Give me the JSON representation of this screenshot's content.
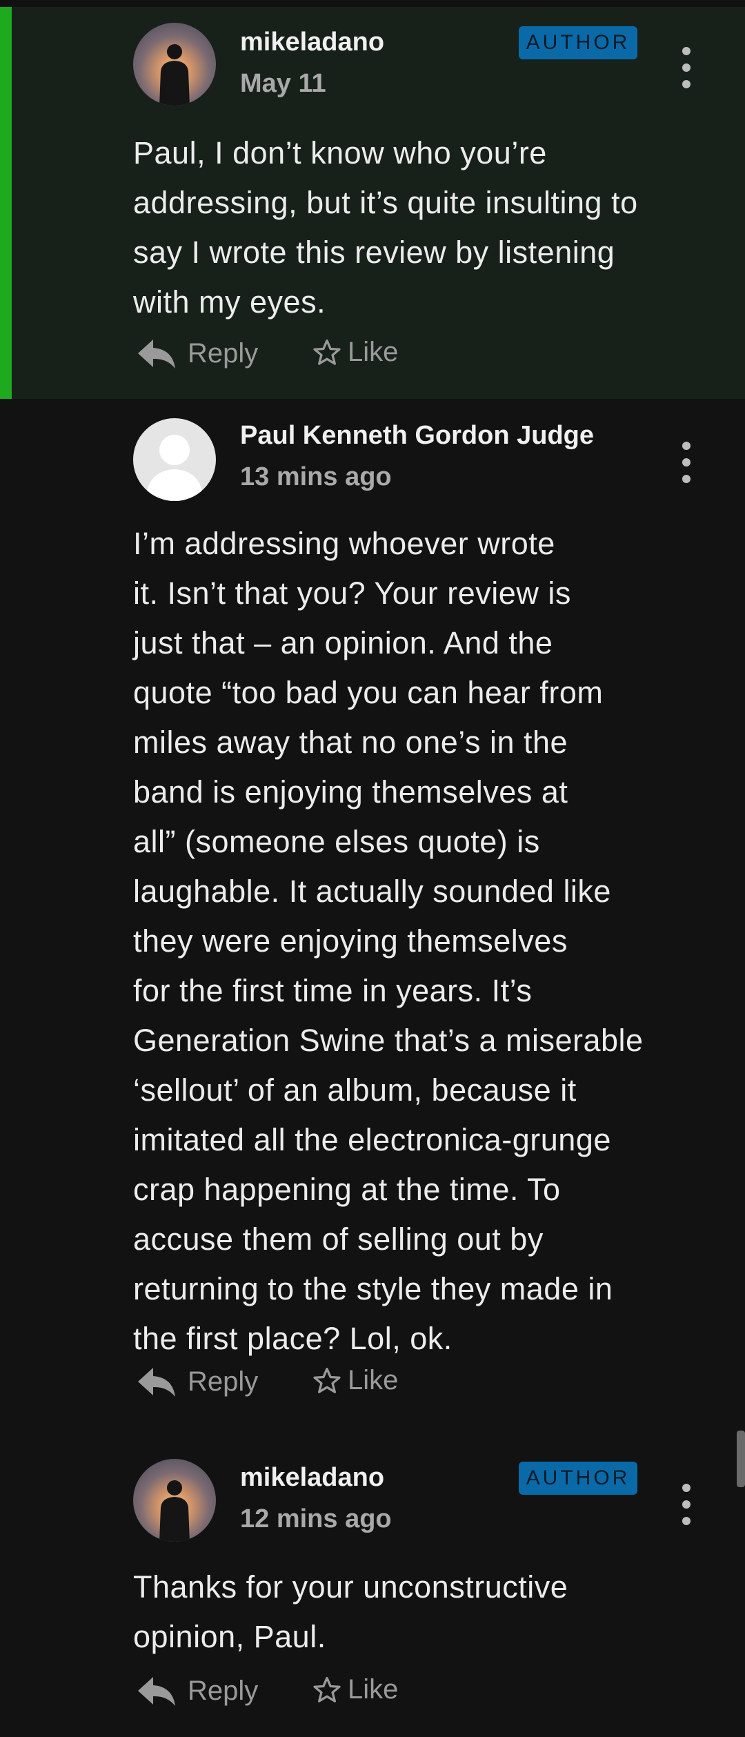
{
  "comments": [
    {
      "username": "mikeladano",
      "badge": "AUTHOR",
      "timestamp": "May 11",
      "avatar": "sunset-photo",
      "lines": [
        "Paul, I don’t know who you’re",
        "addressing, but it’s quite insulting to",
        "say I wrote this review by listening",
        "with my eyes."
      ],
      "reply_label": "Reply",
      "like_label": "Like"
    },
    {
      "username": "Paul Kenneth Gordon Judge",
      "timestamp": "13 mins ago",
      "avatar": "default-user",
      "lines": [
        "I’m addressing whoever wrote",
        "it. Isn’t that you? Your review is",
        "just that – an opinion. And the",
        "quote “too bad you can hear from",
        "miles away that no one’s in the",
        "band is enjoying themselves at",
        "all” (someone elses quote) is",
        "laughable. It actually sounded like",
        "they were enjoying themselves",
        "for the first time in years. It’s",
        "Generation Swine that’s a miserable",
        "‘sellout’ of an album, because it",
        "imitated all the electronica-grunge",
        "crap happening at the time. To",
        "accuse them of selling out by",
        "returning to the style they made in",
        "the first place? Lol, ok."
      ],
      "reply_label": "Reply",
      "like_label": "Like"
    },
    {
      "username": "mikeladano",
      "badge": "AUTHOR",
      "timestamp": "12 mins ago",
      "avatar": "sunset-photo",
      "lines": [
        "Thanks for your unconstructive",
        "opinion, Paul."
      ],
      "reply_label": "Reply",
      "like_label": "Like"
    }
  ],
  "colors": {
    "background": "#121212",
    "highlight_background": "#18201a",
    "accent": "#1ea91e",
    "badge": "#0a6aa8"
  }
}
